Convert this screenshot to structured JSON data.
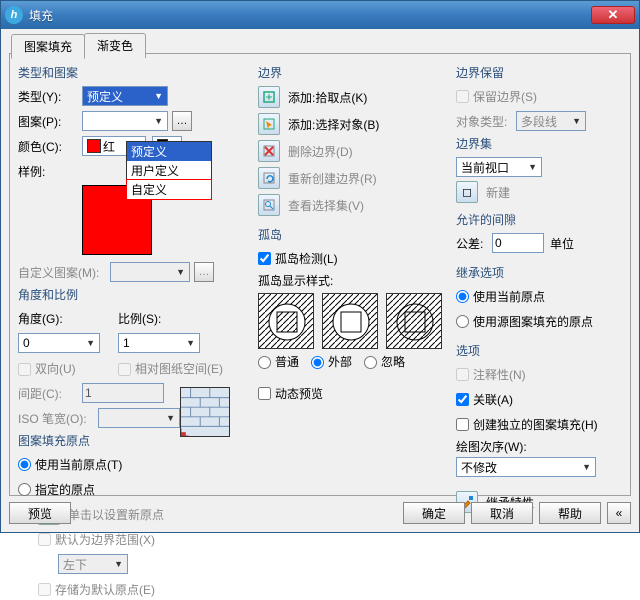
{
  "title": "填充",
  "tabs": {
    "pattern": "图案填充",
    "gradient": "渐变色"
  },
  "left": {
    "sec1": "类型和图案",
    "type_l": "类型(Y):",
    "typeVal": "预定义",
    "dd": {
      "o1": "预定义",
      "o2": "用户定义",
      "o3": "自定义"
    },
    "patt_l": "图案(P):",
    "color_l": "颜色(C):",
    "sample_l": "样例:",
    "custom_l": "自定义图案(M):",
    "sec2": "角度和比例",
    "ang_l": "角度(G):",
    "angVal": "0",
    "scale_l": "比例(S):",
    "scaleVal": "1",
    "dbl": "双向(U)",
    "paper": "相对图纸空间(E)",
    "space_l": "间距(C):",
    "spaceVal": "1",
    "iso_l": "ISO 笔宽(O):",
    "sec3": "图案填充原点",
    "cur": "使用当前原点(T)",
    "spec": "指定的原点",
    "click": "单击以设置新原点",
    "def": "默认为边界范围(X)",
    "lb": "左下",
    "store": "存储为默认原点(E)"
  },
  "mid": {
    "b": "边界",
    "add_pick": "添加:拾取点(K)",
    "add_sel": "添加:选择对象(B)",
    "del": "删除边界(D)",
    "recr": "重新创建边界(R)",
    "view": "查看选择集(V)",
    "isl": "孤岛",
    "isl_det": "孤岛检测(L)",
    "isl_style": "孤岛显示样式:",
    "isl1": "普通",
    "isl2": "外部",
    "isl3": "忽略",
    "dyn": "动态预览"
  },
  "right": {
    "bret": "边界保留",
    "retain": "保留边界(S)",
    "objtype_l": "对象类型:",
    "objtype": "多段线",
    "bset": "边界集",
    "vp": "当前视口",
    "new": "新建",
    "gap": "允许的间隙",
    "tol_l": "公差:",
    "tolVal": "0",
    "unit": "单位",
    "inh": "继承选项",
    "inh1": "使用当前原点",
    "inh2": "使用源图案填充的原点",
    "opts": "选项",
    "anno": "注释性(N)",
    "assoc": "关联(A)",
    "indep": "创建独立的图案填充(H)",
    "order_l": "绘图次序(W):",
    "order": "不修改",
    "inhprop": "继承特性"
  },
  "footer": {
    "preview": "预览",
    "ok": "确定",
    "cancel": "取消",
    "help": "帮助"
  }
}
